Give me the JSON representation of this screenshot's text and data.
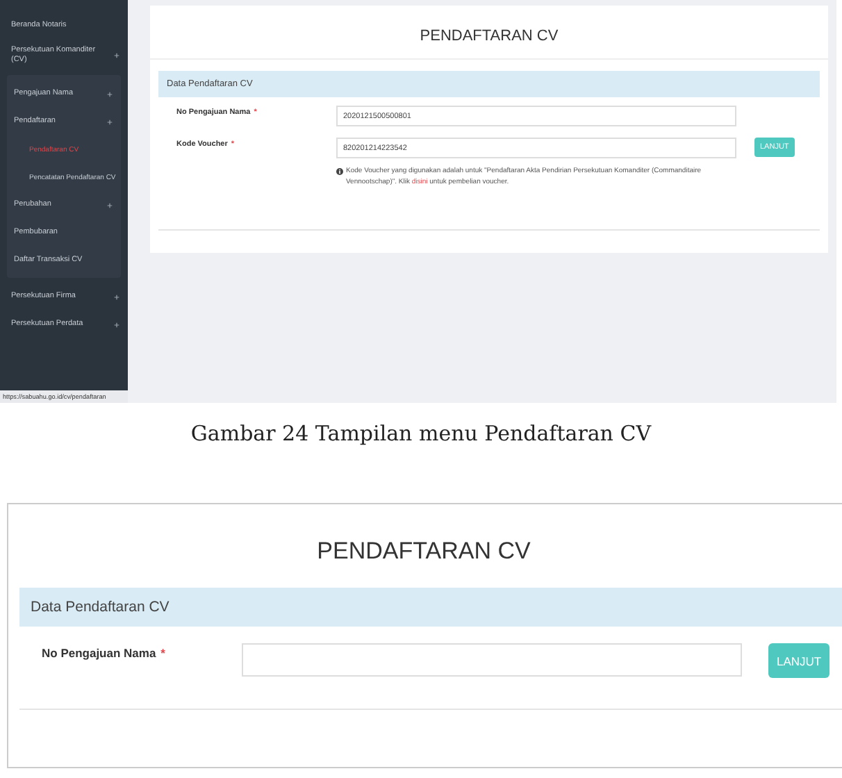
{
  "screen_1": {
    "sidebar": {
      "items": [
        {
          "label": "Beranda Notaris",
          "expandable": false,
          "selected": false
        },
        {
          "label": "Persekutuan Komanditer (CV)",
          "expandable": true,
          "selected": false,
          "children": [
            {
              "label": "Pengajuan Nama",
              "expandable": true,
              "selected": false
            },
            {
              "label": "Pendaftaran",
              "expandable": true,
              "selected": false,
              "children": [
                {
                  "label": "Pendaftaran CV",
                  "selected": true
                },
                {
                  "label": "Pencatatan Pendaftaran CV",
                  "selected": false
                }
              ]
            },
            {
              "label": "Perubahan",
              "expandable": true,
              "selected": false
            },
            {
              "label": "Pembubaran",
              "expandable": false,
              "selected": false
            },
            {
              "label": "Daftar Transaksi CV",
              "expandable": false,
              "selected": false
            }
          ]
        },
        {
          "label": "Persekutuan Firma",
          "expandable": true,
          "selected": false
        },
        {
          "label": "Persekutuan Perdata",
          "expandable": true,
          "selected": false
        }
      ]
    },
    "status_url": "https://sabuahu.go.id/cv/pendaftaran",
    "form": {
      "title": "PENDAFTARAN CV",
      "section": "Data Pendaftaran CV",
      "fields": [
        {
          "label": "No Pengajuan Nama",
          "required_mark": "*",
          "value": "2020121500500801"
        },
        {
          "label": "Kode Voucher",
          "required_mark": "*",
          "value": "820201214223542",
          "button": "LANJUT"
        }
      ],
      "note": {
        "before": "Kode Voucher yang digunakan adalah untuk \"Pendaftaran Akta Pendirian Persekutuan Komanditer (Commanditaire Vennootschap)\". Klik",
        "link": "disini",
        "after": "untuk pembelian voucher."
      }
    }
  },
  "caption": "Gambar 24 Tampilan menu Pendaftaran CV",
  "screen_2": {
    "form": {
      "title": "PENDAFTARAN CV",
      "section": "Data Pendaftaran CV",
      "fields": [
        {
          "label": "No Pengajuan Nama",
          "required_mark": "*",
          "button": "LANJUT"
        }
      ]
    }
  }
}
